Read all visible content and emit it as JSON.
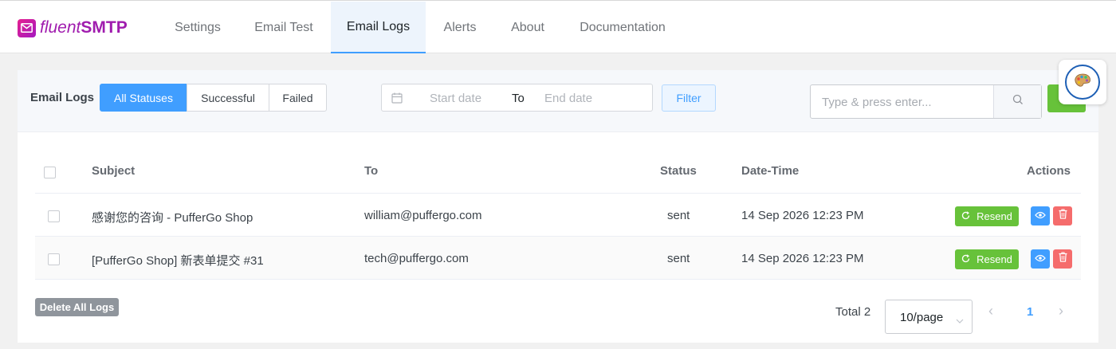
{
  "brand": {
    "name_part1": "fluent",
    "name_part2": "SMTP"
  },
  "nav": {
    "tabs": [
      {
        "label": "Settings"
      },
      {
        "label": "Email Test"
      },
      {
        "label": "Email Logs"
      },
      {
        "label": "Alerts"
      },
      {
        "label": "About"
      },
      {
        "label": "Documentation"
      }
    ],
    "active_tab": "Email Logs"
  },
  "toolbar": {
    "title": "Email Logs",
    "status_filters": [
      "All Statuses",
      "Successful",
      "Failed"
    ],
    "active_status": "All Statuses",
    "date_start_placeholder": "Start date",
    "date_separator": "To",
    "date_end_placeholder": "End date",
    "filter_label": "Filter",
    "search_placeholder": "Type & press enter..."
  },
  "table": {
    "headers": {
      "subject": "Subject",
      "to": "To",
      "status": "Status",
      "datetime": "Date-Time",
      "actions": "Actions"
    },
    "rows": [
      {
        "subject": "感谢您的咨询 - PufferGo Shop",
        "to": "william@puffergo.com",
        "status": "sent",
        "datetime": "14 Sep 2026 12:23 PM",
        "resend_label": "Resend"
      },
      {
        "subject": "[PufferGo Shop] 新表单提交 #31",
        "to": "tech@puffergo.com",
        "status": "sent",
        "datetime": "14 Sep 2026 12:23 PM",
        "resend_label": "Resend"
      }
    ]
  },
  "footer": {
    "delete_all_label": "Delete All Logs",
    "total_label": "Total 2",
    "page_size": "10/page",
    "current_page": "1"
  },
  "colors": {
    "primary": "#409eff",
    "success": "#67c23a",
    "danger": "#f56c6c",
    "brand": "#a01cae"
  }
}
